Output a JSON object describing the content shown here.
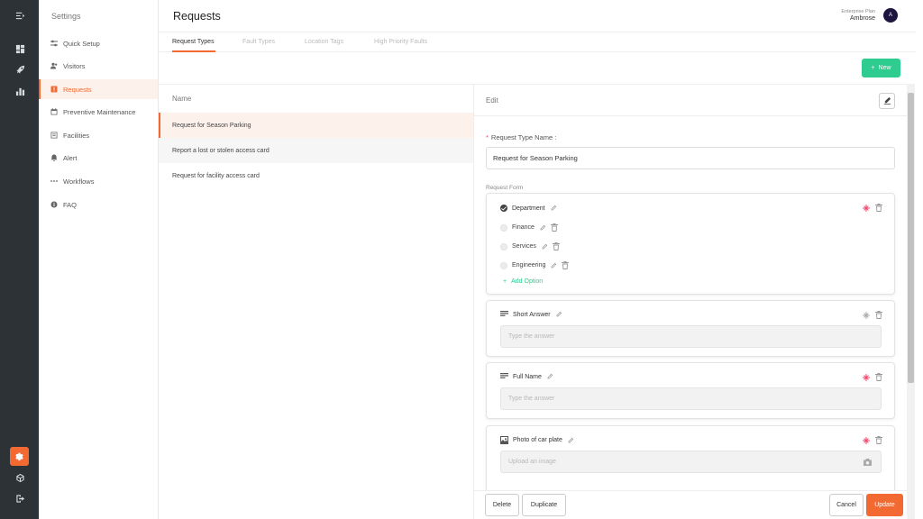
{
  "app": {
    "settings_title": "Settings",
    "page_title": "Requests"
  },
  "account": {
    "plan": "Enterprise Plan",
    "user": "Ambrose",
    "initial": "A"
  },
  "sidebar": {
    "items": [
      {
        "label": "Quick Setup",
        "icon": "sliders-icon"
      },
      {
        "label": "Visitors",
        "icon": "visitors-icon"
      },
      {
        "label": "Requests",
        "icon": "request-icon"
      },
      {
        "label": "Preventive Maintenance",
        "icon": "calendar-icon"
      },
      {
        "label": "Facilities",
        "icon": "facilities-icon"
      },
      {
        "label": "Alert",
        "icon": "bell-icon"
      },
      {
        "label": "Workflows",
        "icon": "workflow-icon"
      },
      {
        "label": "FAQ",
        "icon": "info-icon"
      }
    ]
  },
  "tabs": [
    "Request Types",
    "Fault Types",
    "Location Tags",
    "High Priority Faults"
  ],
  "toolbar": {
    "new_label": "New"
  },
  "list": {
    "header": "Name",
    "rows": [
      "Request for Season Parking",
      "Report a lost or stolen access card",
      "Request for facility access card"
    ]
  },
  "edit": {
    "title": "Edit",
    "name_label": "Request Type Name :",
    "name_value": "Request for Season Parking",
    "form_label": "Request Form",
    "dropdown_field": {
      "label": "Department",
      "options": [
        "Finance",
        "Services",
        "Engineering"
      ],
      "add_option": "Add Option",
      "required": true
    },
    "fields": [
      {
        "label": "Short Answer",
        "placeholder": "Type the answer",
        "required": false,
        "icon": "lines-icon"
      },
      {
        "label": "Full Name",
        "placeholder": "Type the answer",
        "required": true,
        "icon": "lines-icon"
      },
      {
        "label": "Photo of car plate",
        "placeholder": "Upload an image",
        "required": true,
        "icon": "image-icon"
      }
    ]
  },
  "footer": {
    "delete": "Delete",
    "duplicate": "Duplicate",
    "cancel": "Cancel",
    "update": "Update"
  },
  "colors": {
    "accent": "#f26a32",
    "success": "#2ecc8f",
    "required": "#f5476b",
    "rail": "#2d3237"
  }
}
